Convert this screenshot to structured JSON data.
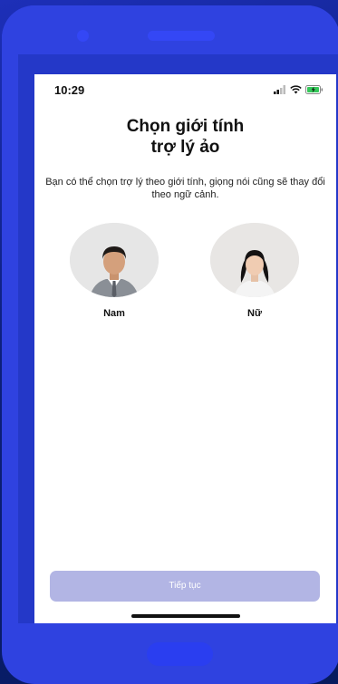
{
  "status_bar": {
    "time": "10:29"
  },
  "title_line1": "Chọn giới tính",
  "title_line2": "trợ lý ảo",
  "subtitle": "Bạn có thể chọn trợ lý theo giới tính, giọng nói cũng sẽ thay đổi theo ngữ cảnh.",
  "options": [
    {
      "label": "Nam"
    },
    {
      "label": "Nữ"
    }
  ],
  "continue_label": "Tiếp tục",
  "colors": {
    "phone_body": "#2f42e0",
    "button_disabled": "#b2b5e4",
    "avatar_bg": "#e6e6e6"
  }
}
